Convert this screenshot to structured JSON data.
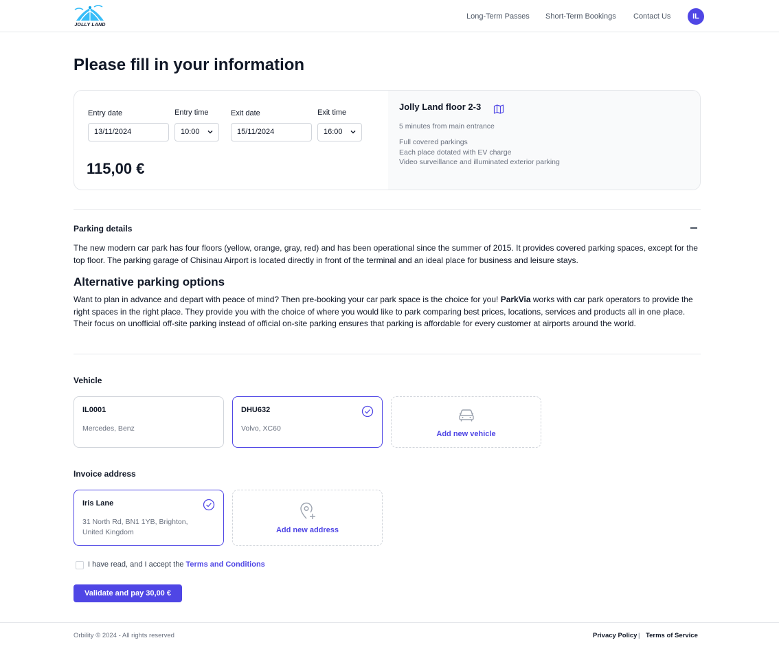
{
  "header": {
    "logo_text": "JOLLY LAND",
    "nav": [
      "Long-Term Passes",
      "Short-Term Bookings",
      "Contact Us"
    ],
    "avatar_initials": "IL"
  },
  "page_title": "Please fill in your information",
  "booking": {
    "entry_date_label": "Entry date",
    "entry_date_value": "13/11/2024",
    "entry_time_label": "Entry time",
    "entry_time_value": "10:00",
    "exit_date_label": "Exit date",
    "exit_date_value": "15/11/2024",
    "exit_time_label": "Exit time",
    "exit_time_value": "16:00",
    "price": "115,00 €"
  },
  "location": {
    "title": "Jolly Land floor 2-3",
    "distance": "5 minutes from main entrance",
    "features": [
      "Full covered parkings",
      "Each place dotated with EV charge",
      "Video surveillance and illuminated exterior parking"
    ]
  },
  "parking_details": {
    "title": "Parking details",
    "text": "The new modern car park has four floors (yellow, orange, gray, red) and has been operational since the summer of 2015. It provides covered parking spaces, except for the top floor. The parking garage of Chisinau Airport is located directly in front of the terminal and an ideal place for business and leisure stays."
  },
  "alternative": {
    "title": "Alternative parking options",
    "text_before": "Want to plan in advance and depart with peace of mind? Then pre-booking your car park space is the choice for you! ",
    "brand": "ParkVia",
    "text_after": " works with car park operators to provide the right spaces in the right place. They provide you with the choice of where you would like to park comparing best prices, locations, services and products all in one place. Their focus on unofficial off-site parking instead of official on-site parking ensures that parking is affordable for every customer at airports around the world."
  },
  "vehicle": {
    "title": "Vehicle",
    "items": [
      {
        "plate": "IL0001",
        "model": "Mercedes, Benz",
        "selected": false
      },
      {
        "plate": "DHU632",
        "model": "Volvo, XC60",
        "selected": true
      }
    ],
    "add_label": "Add new vehicle"
  },
  "invoice": {
    "title": "Invoice address",
    "items": [
      {
        "name": "Iris Lane",
        "address": "31 North Rd, BN1 1YB, Brighton, United Kingdom",
        "selected": true
      }
    ],
    "add_label": "Add new address"
  },
  "terms": {
    "text": "I have read, and I accept the ",
    "link": "Terms and Conditions"
  },
  "pay_button": "Validate and pay 30,00 €",
  "footer": {
    "copyright": "Orbility © 2024 - All rights reserved",
    "separator": "|",
    "privacy": "Privacy Policy",
    "tos": "Terms of Service"
  },
  "colors": {
    "accent": "#4f46e5",
    "muted_text": "#6b7280",
    "border": "#e5e7eb",
    "panel_bg": "#f9fafb"
  }
}
